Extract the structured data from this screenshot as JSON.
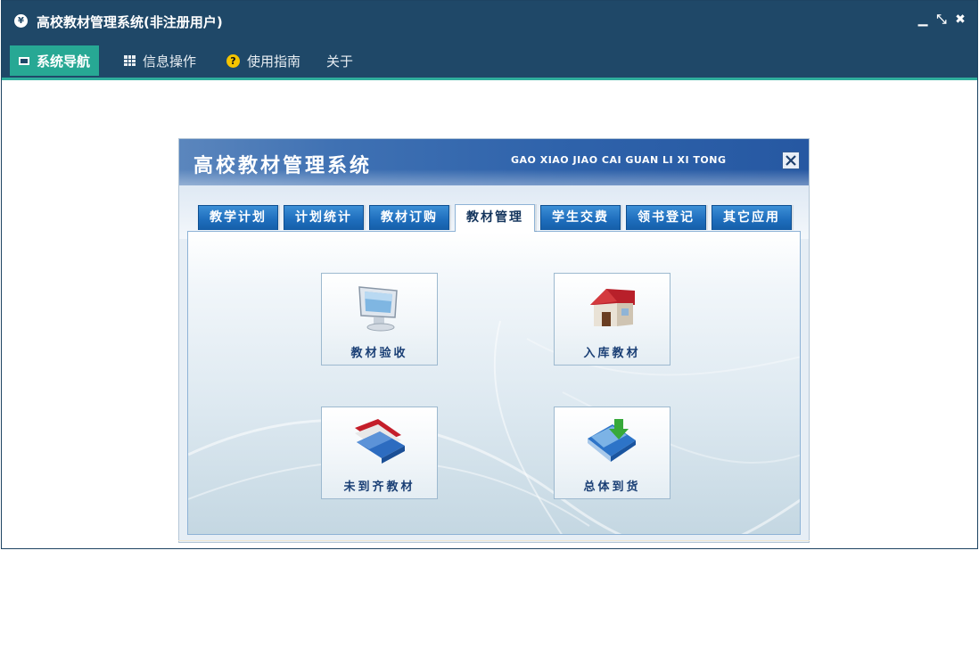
{
  "window": {
    "title": "高校教材管理系统(非注册用户)",
    "app_icon": "app-logo-icon",
    "controls": [
      {
        "name": "minimize-icon",
        "glyph": "▁"
      },
      {
        "name": "restore-icon",
        "glyph": "⤡"
      },
      {
        "name": "close-icon",
        "glyph": "✖"
      }
    ]
  },
  "menu": {
    "items": [
      {
        "label": "系统导航",
        "icon": "monitor-icon",
        "active": true
      },
      {
        "label": "信息操作",
        "icon": "grid-icon",
        "active": false
      },
      {
        "label": "使用指南",
        "icon": "help-icon",
        "active": false
      },
      {
        "label": "关于",
        "icon": "",
        "active": false
      }
    ]
  },
  "app": {
    "title": "高校教材管理系统",
    "subtitle": "GAO XIAO JIAO CAI GUAN LI XI TONG",
    "tabs": [
      {
        "label": "教学计划",
        "active": false
      },
      {
        "label": "计划统计",
        "active": false
      },
      {
        "label": "教材订购",
        "active": false
      },
      {
        "label": "教材管理",
        "active": true
      },
      {
        "label": "学生交费",
        "active": false
      },
      {
        "label": "领书登记",
        "active": false
      },
      {
        "label": "其它应用",
        "active": false
      }
    ],
    "buttons": [
      {
        "label": "教材验收",
        "icon": "monitor-icon"
      },
      {
        "label": "入库教材",
        "icon": "house-icon"
      },
      {
        "label": "未到齐教材",
        "icon": "folders-icon"
      },
      {
        "label": "总体到货",
        "icon": "download-icon"
      }
    ]
  },
  "colors": {
    "titlebar": "#1f4868",
    "menu_active": "#27a894",
    "accent_line": "#2fae9d",
    "tab_blue": "#1f6fbe",
    "button_text": "#1a3f75"
  }
}
